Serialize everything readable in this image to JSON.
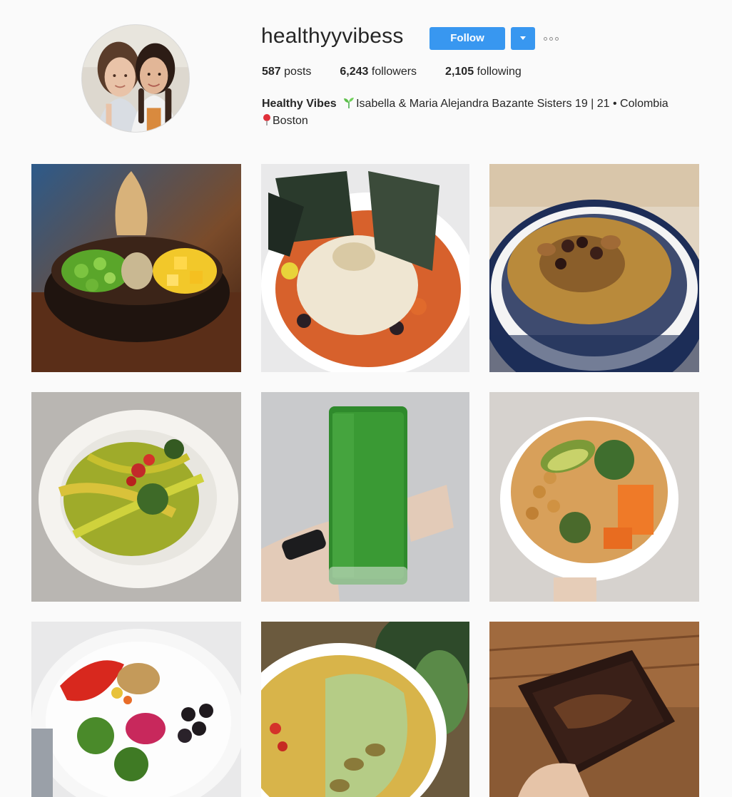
{
  "profile": {
    "username": "healthyyvibess",
    "follow_label": "Follow",
    "stats": {
      "posts_count": "587",
      "posts_label": "posts",
      "followers_count": "6,243",
      "followers_label": "followers",
      "following_count": "2,105",
      "following_label": "following"
    },
    "bio": {
      "name": "Healthy Vibes",
      "line1": "Isabella & Maria Alejandra Bazante Sisters 19 | 21 • Colombia",
      "location": "Boston"
    }
  },
  "icons": {
    "more": "more-options-icon",
    "dropdown": "chevron-down-icon",
    "bio_emoji_1": "seedling-icon",
    "bio_emoji_2": "location-pin-icon"
  },
  "colors": {
    "accent": "#3897f0",
    "background": "#fafafa",
    "text": "#262626"
  }
}
